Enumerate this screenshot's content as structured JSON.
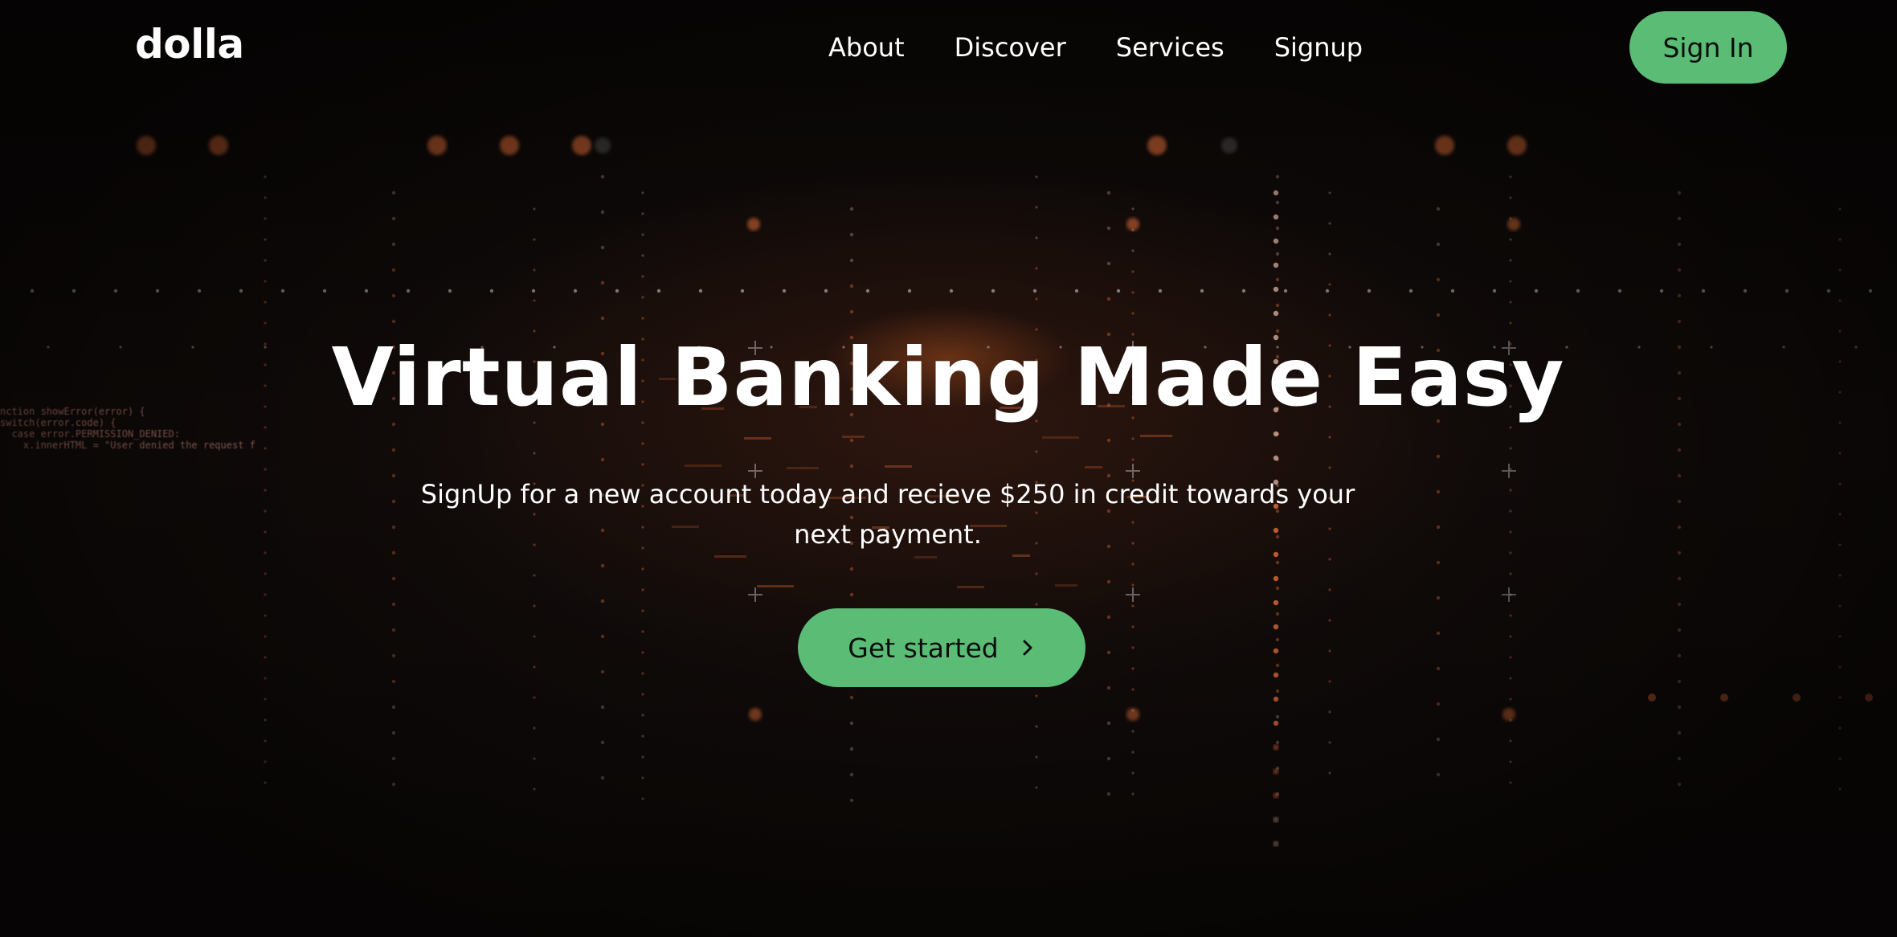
{
  "navbar": {
    "logo": "dolla",
    "links": [
      "About",
      "Discover",
      "Services",
      "Signup"
    ],
    "signin_label": "Sign In"
  },
  "hero": {
    "title": "Virtual Banking Made Easy",
    "subtitle": "SignUp for a new account today and recieve $250 in credit towards your next payment.",
    "cta_label": "Get started",
    "cta_icon": "chevron-right-icon"
  },
  "background": {
    "code_lines": [
      "nction showError(error) {",
      "switch(error.code) {",
      "  case error.PERMISSION_DENIED:",
      "    x.innerHTML = \"User denied the request f"
    ]
  },
  "colors": {
    "accent": "#5bbc76",
    "background": "#0c0807",
    "glow": "#ff7a3c",
    "text": "#ffffff"
  }
}
